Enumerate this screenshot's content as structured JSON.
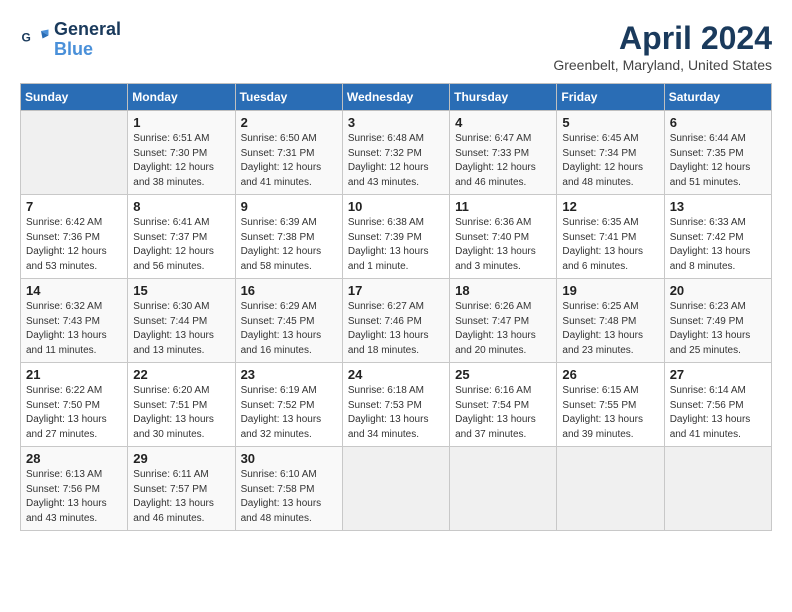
{
  "header": {
    "logo_line1": "General",
    "logo_line2": "Blue",
    "title": "April 2024",
    "location": "Greenbelt, Maryland, United States"
  },
  "days_of_week": [
    "Sunday",
    "Monday",
    "Tuesday",
    "Wednesday",
    "Thursday",
    "Friday",
    "Saturday"
  ],
  "weeks": [
    [
      {
        "day": "",
        "empty": true
      },
      {
        "day": "1",
        "sunrise": "6:51 AM",
        "sunset": "7:30 PM",
        "daylight": "12 hours and 38 minutes."
      },
      {
        "day": "2",
        "sunrise": "6:50 AM",
        "sunset": "7:31 PM",
        "daylight": "12 hours and 41 minutes."
      },
      {
        "day": "3",
        "sunrise": "6:48 AM",
        "sunset": "7:32 PM",
        "daylight": "12 hours and 43 minutes."
      },
      {
        "day": "4",
        "sunrise": "6:47 AM",
        "sunset": "7:33 PM",
        "daylight": "12 hours and 46 minutes."
      },
      {
        "day": "5",
        "sunrise": "6:45 AM",
        "sunset": "7:34 PM",
        "daylight": "12 hours and 48 minutes."
      },
      {
        "day": "6",
        "sunrise": "6:44 AM",
        "sunset": "7:35 PM",
        "daylight": "12 hours and 51 minutes."
      }
    ],
    [
      {
        "day": "7",
        "sunrise": "6:42 AM",
        "sunset": "7:36 PM",
        "daylight": "12 hours and 53 minutes."
      },
      {
        "day": "8",
        "sunrise": "6:41 AM",
        "sunset": "7:37 PM",
        "daylight": "12 hours and 56 minutes."
      },
      {
        "day": "9",
        "sunrise": "6:39 AM",
        "sunset": "7:38 PM",
        "daylight": "12 hours and 58 minutes."
      },
      {
        "day": "10",
        "sunrise": "6:38 AM",
        "sunset": "7:39 PM",
        "daylight": "13 hours and 1 minute."
      },
      {
        "day": "11",
        "sunrise": "6:36 AM",
        "sunset": "7:40 PM",
        "daylight": "13 hours and 3 minutes."
      },
      {
        "day": "12",
        "sunrise": "6:35 AM",
        "sunset": "7:41 PM",
        "daylight": "13 hours and 6 minutes."
      },
      {
        "day": "13",
        "sunrise": "6:33 AM",
        "sunset": "7:42 PM",
        "daylight": "13 hours and 8 minutes."
      }
    ],
    [
      {
        "day": "14",
        "sunrise": "6:32 AM",
        "sunset": "7:43 PM",
        "daylight": "13 hours and 11 minutes."
      },
      {
        "day": "15",
        "sunrise": "6:30 AM",
        "sunset": "7:44 PM",
        "daylight": "13 hours and 13 minutes."
      },
      {
        "day": "16",
        "sunrise": "6:29 AM",
        "sunset": "7:45 PM",
        "daylight": "13 hours and 16 minutes."
      },
      {
        "day": "17",
        "sunrise": "6:27 AM",
        "sunset": "7:46 PM",
        "daylight": "13 hours and 18 minutes."
      },
      {
        "day": "18",
        "sunrise": "6:26 AM",
        "sunset": "7:47 PM",
        "daylight": "13 hours and 20 minutes."
      },
      {
        "day": "19",
        "sunrise": "6:25 AM",
        "sunset": "7:48 PM",
        "daylight": "13 hours and 23 minutes."
      },
      {
        "day": "20",
        "sunrise": "6:23 AM",
        "sunset": "7:49 PM",
        "daylight": "13 hours and 25 minutes."
      }
    ],
    [
      {
        "day": "21",
        "sunrise": "6:22 AM",
        "sunset": "7:50 PM",
        "daylight": "13 hours and 27 minutes."
      },
      {
        "day": "22",
        "sunrise": "6:20 AM",
        "sunset": "7:51 PM",
        "daylight": "13 hours and 30 minutes."
      },
      {
        "day": "23",
        "sunrise": "6:19 AM",
        "sunset": "7:52 PM",
        "daylight": "13 hours and 32 minutes."
      },
      {
        "day": "24",
        "sunrise": "6:18 AM",
        "sunset": "7:53 PM",
        "daylight": "13 hours and 34 minutes."
      },
      {
        "day": "25",
        "sunrise": "6:16 AM",
        "sunset": "7:54 PM",
        "daylight": "13 hours and 37 minutes."
      },
      {
        "day": "26",
        "sunrise": "6:15 AM",
        "sunset": "7:55 PM",
        "daylight": "13 hours and 39 minutes."
      },
      {
        "day": "27",
        "sunrise": "6:14 AM",
        "sunset": "7:56 PM",
        "daylight": "13 hours and 41 minutes."
      }
    ],
    [
      {
        "day": "28",
        "sunrise": "6:13 AM",
        "sunset": "7:56 PM",
        "daylight": "13 hours and 43 minutes."
      },
      {
        "day": "29",
        "sunrise": "6:11 AM",
        "sunset": "7:57 PM",
        "daylight": "13 hours and 46 minutes."
      },
      {
        "day": "30",
        "sunrise": "6:10 AM",
        "sunset": "7:58 PM",
        "daylight": "13 hours and 48 minutes."
      },
      {
        "day": "",
        "empty": true
      },
      {
        "day": "",
        "empty": true
      },
      {
        "day": "",
        "empty": true
      },
      {
        "day": "",
        "empty": true
      }
    ]
  ],
  "labels": {
    "sunrise": "Sunrise:",
    "sunset": "Sunset:",
    "daylight": "Daylight:"
  }
}
